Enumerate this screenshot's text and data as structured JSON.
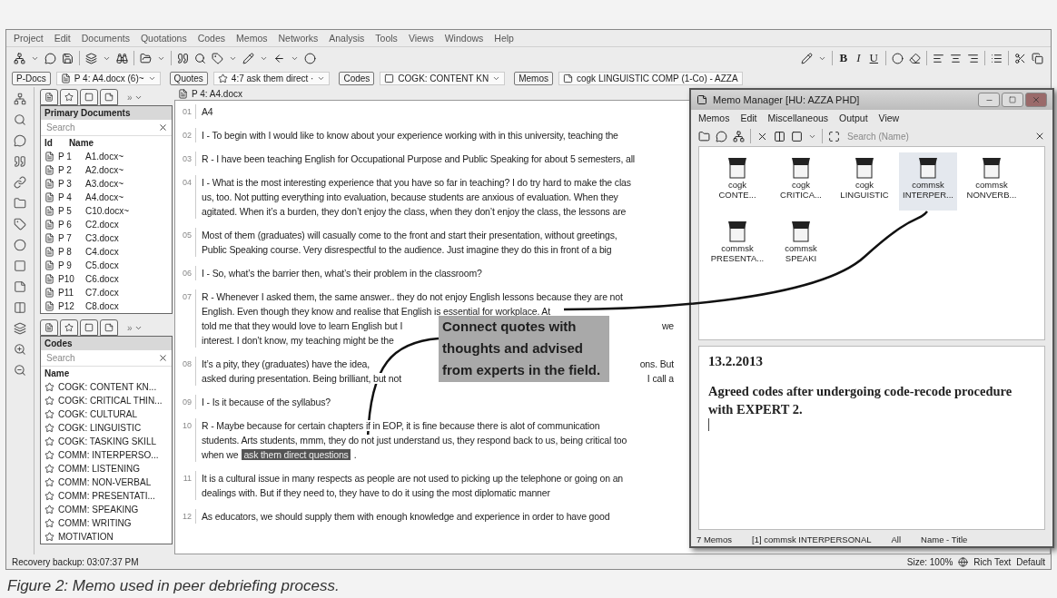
{
  "menu": [
    "Project",
    "Edit",
    "Documents",
    "Quotations",
    "Codes",
    "Memos",
    "Networks",
    "Analysis",
    "Tools",
    "Views",
    "Windows",
    "Help"
  ],
  "format_toolbar": {
    "bold": "B",
    "italic": "I",
    "underline": "U"
  },
  "doc_bar": [
    {
      "button": "P-Docs",
      "value": "P 4: A4.docx (6)~",
      "has_caret": true
    },
    {
      "button": "Quotes",
      "value": "4:7 ask them direct ·",
      "has_caret": true
    },
    {
      "button": "Codes",
      "value": "COGK: CONTENT KN",
      "has_caret": true
    },
    {
      "button": "Memos",
      "value": "cogk LINGUISTIC COMP (1-Co) - AZZA",
      "has_caret": false
    }
  ],
  "primary_documents": {
    "overflow": "»",
    "title": "Primary Documents",
    "placeholder": "Search",
    "columns": [
      "Id",
      "Name"
    ],
    "rows": [
      {
        "id": "P 1",
        "name": "A1.docx~"
      },
      {
        "id": "P 2",
        "name": "A2.docx~"
      },
      {
        "id": "P 3",
        "name": "A3.docx~"
      },
      {
        "id": "P 4",
        "name": "A4.docx~"
      },
      {
        "id": "P 5",
        "name": "C10.docx~"
      },
      {
        "id": "P 6",
        "name": "C2.docx"
      },
      {
        "id": "P 7",
        "name": "C3.docx"
      },
      {
        "id": "P 8",
        "name": "C4.docx"
      },
      {
        "id": "P 9",
        "name": "C5.docx"
      },
      {
        "id": "P10",
        "name": "C6.docx"
      },
      {
        "id": "P11",
        "name": "C7.docx"
      },
      {
        "id": "P12",
        "name": "C8.docx"
      }
    ]
  },
  "codes": {
    "overflow": "»",
    "title": "Codes",
    "placeholder": "Search",
    "column": "Name",
    "items": [
      "COGK: CONTENT KN...",
      "COGK: CRITICAL THIN...",
      "COGK: CULTURAL",
      "COGK: LINGUISTIC",
      "COGK: TASKING SKILL",
      "COMM: INTERPERSO...",
      "COMM: LISTENING",
      "COMM: NON-VERBAL",
      "COMM: PRESENTATI...",
      "COMM: SPEAKING",
      "COMM: WRITING",
      "MOTIVATION"
    ]
  },
  "document": {
    "title": "P 4: A4.docx",
    "paragraphs": [
      {
        "number": "01",
        "lines": [
          [
            {
              "kind": "text",
              "text": "A4"
            }
          ]
        ]
      },
      {
        "number": "02",
        "lines": [
          [
            {
              "kind": "text",
              "text": "I - To begin with I would like to know about your experience working with in this university, teaching the"
            }
          ]
        ]
      },
      {
        "number": "03",
        "lines": [
          [
            {
              "kind": "text",
              "text": "R - I have been teaching English for Occupational Purpose and Public Speaking for about 5 semesters, all"
            }
          ]
        ]
      },
      {
        "number": "04",
        "lines": [
          [
            {
              "kind": "text",
              "text": "I - What is the most interesting experience that you have so far in teaching? I do try hard to make the clas"
            }
          ],
          [
            {
              "kind": "text",
              "text": "us, too. Not putting everything into evaluation, because students are anxious of evaluation. When they"
            }
          ],
          [
            {
              "kind": "text",
              "text": "agitated. When it’s a burden, they don’t enjoy the class, when they don’t enjoy the class, the lessons are"
            }
          ]
        ]
      },
      {
        "number": "05",
        "lines": [
          [
            {
              "kind": "text",
              "text": "Most of them (graduates) will casually come to the front and start their presentation, without greetings,"
            }
          ],
          [
            {
              "kind": "text",
              "text": "Public Speaking course. Very disrespectful to the audience. Just imagine they do this in front of a big"
            }
          ]
        ]
      },
      {
        "number": "06",
        "lines": [
          [
            {
              "kind": "text",
              "text": "I - So, what’s the barrier then, what’s their problem in the classroom?"
            }
          ]
        ]
      },
      {
        "number": "07",
        "lines": [
          [
            {
              "kind": "text",
              "text": "R - Whenever I asked them, the same answer.. they do not enjoy English lessons because they are not"
            }
          ],
          [
            {
              "kind": "text",
              "text": "English. Even though they know and realise that English is essential for workplace. At"
            }
          ],
          [
            {
              "kind": "text",
              "text": "told me that they would love to learn English but I"
            },
            {
              "kind": "tail",
              "text": "we"
            }
          ],
          [
            {
              "kind": "text",
              "text": "interest. I don’t know, my teaching might be the"
            }
          ]
        ]
      },
      {
        "number": "08",
        "lines": [
          [
            {
              "kind": "text",
              "text": "It’s a pity, they (graduates) have the idea,"
            },
            {
              "kind": "tail",
              "text": "ons. But"
            }
          ],
          [
            {
              "kind": "text",
              "text": "asked during presentation. Being brilliant, but not"
            },
            {
              "kind": "tail",
              "text": "I call a"
            }
          ]
        ]
      },
      {
        "number": "09",
        "lines": [
          [
            {
              "kind": "text",
              "text": "I - Is it because of the syllabus?"
            }
          ]
        ]
      },
      {
        "number": "10",
        "lines": [
          [
            {
              "kind": "text",
              "text": "R - Maybe because for certain chapters if in EOP, it is fine because there is alot of communication"
            }
          ],
          [
            {
              "kind": "text",
              "text": "students. Arts students, mmm, they do not just understand us, they respond back to us, being critical too"
            }
          ],
          [
            {
              "kind": "text",
              "text": "when we"
            },
            {
              "kind": "quote",
              "text": "ask them direct questions"
            },
            {
              "kind": "text",
              "text": "."
            }
          ]
        ]
      },
      {
        "number": "11",
        "lines": [
          [
            {
              "kind": "text",
              "text": "It is a cultural issue in many respects as people are not used to picking up the telephone or going on an"
            }
          ],
          [
            {
              "kind": "text",
              "text": "dealings with. But if they need to, they have to do it using the most diplomatic manner"
            }
          ]
        ]
      },
      {
        "number": "12",
        "lines": [
          [
            {
              "kind": "text",
              "text": "As educators, we should supply them with enough knowledge and experience in order to have good"
            }
          ]
        ]
      }
    ]
  },
  "callout": "Connect quotes with thoughts and advised from experts in the field.",
  "memo_manager": {
    "title": "Memo Manager [HU: AZZA PHD]",
    "menu": [
      "Memos",
      "Edit",
      "Miscellaneous",
      "Output",
      "View"
    ],
    "placeholder": "Search (Name)",
    "memos": [
      {
        "type": "cogk",
        "name": "CONTE...",
        "selected": false
      },
      {
        "type": "cogk",
        "name": "CRITICA...",
        "selected": false
      },
      {
        "type": "cogk",
        "name": "LINGUISTIC",
        "selected": false
      },
      {
        "type": "commsk",
        "name": "INTERPER...",
        "selected": true
      },
      {
        "type": "commsk",
        "name": "NONVERB...",
        "selected": false
      },
      {
        "type": "commsk",
        "name": "PRESENTA...",
        "selected": false
      },
      {
        "type": "commsk",
        "name": "SPEAKI",
        "selected": false
      }
    ],
    "memo_date": "13.2.2013",
    "memo_text": "Agreed codes after undergoing code-recode procedure with EXPERT 2.",
    "status": [
      "7 Memos",
      "[1] commsk INTERPERSONAL",
      "All",
      "Name - Title"
    ]
  },
  "status_bar": {
    "left": "Recovery backup: 03:07:37 PM",
    "size": "Size: 100%",
    "format": "Rich Text",
    "style": "Default"
  },
  "caption": "Figure 2: Memo used in peer debriefing process."
}
